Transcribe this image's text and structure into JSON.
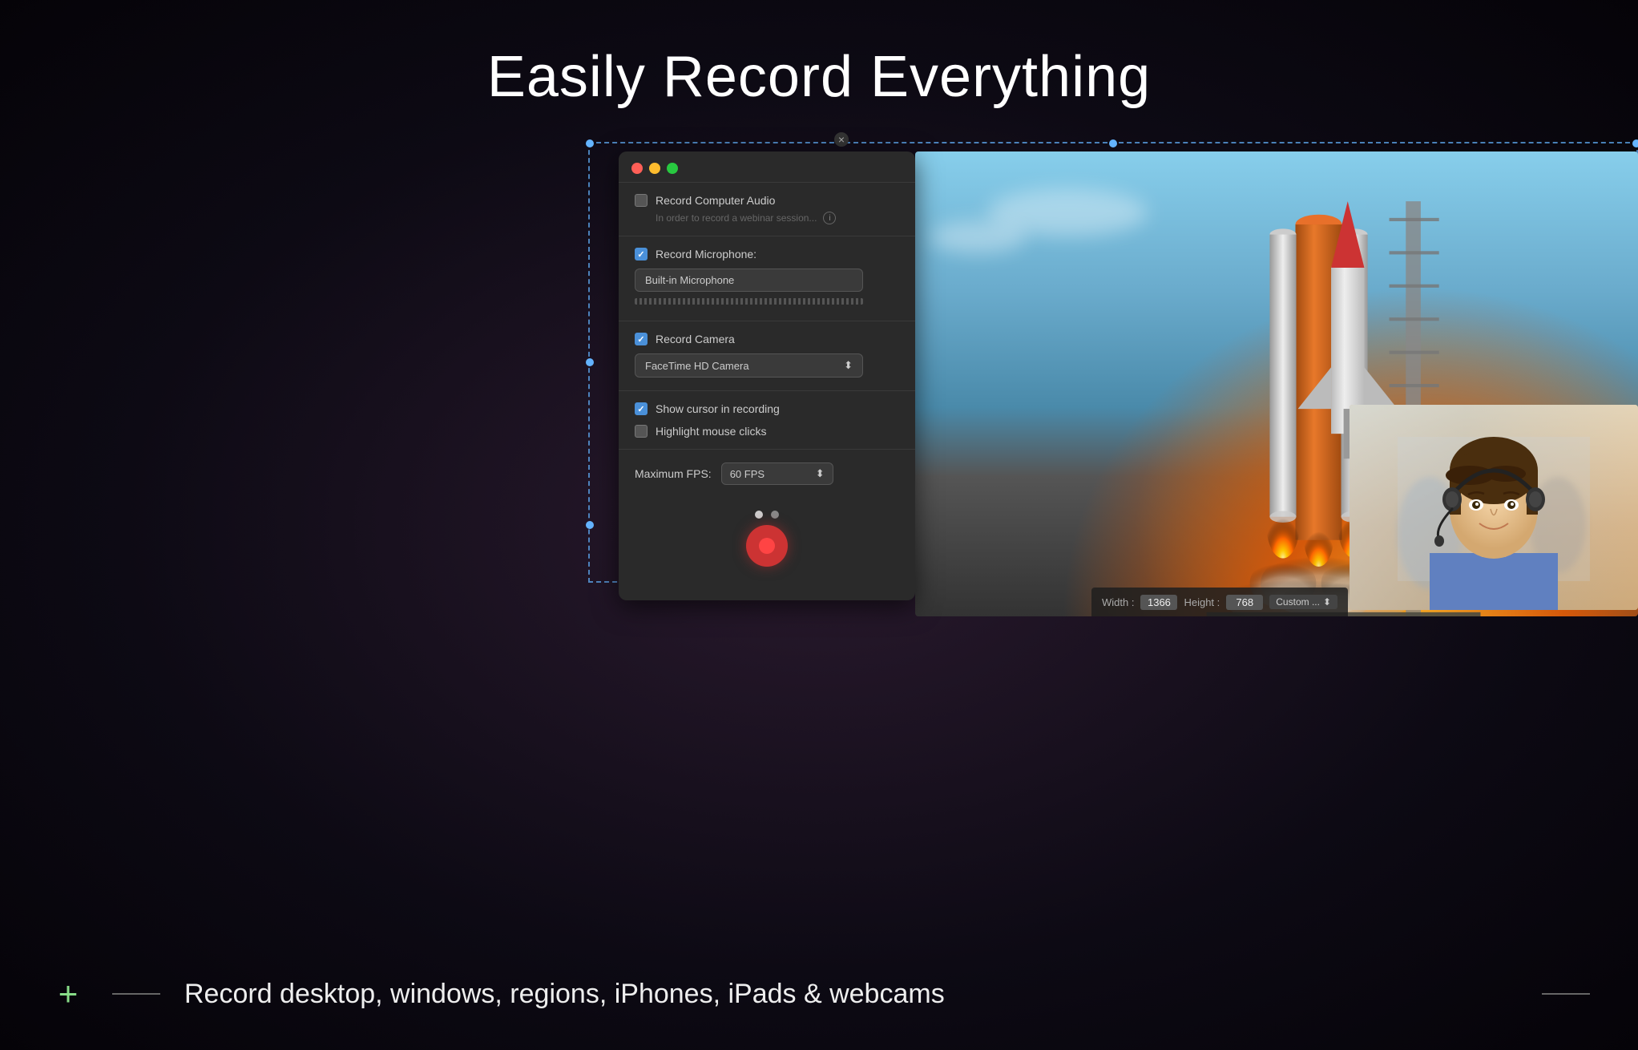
{
  "page": {
    "title": "Easily Record Everything",
    "subtitle": "Record desktop, windows, regions, iPhones, iPads & webcams"
  },
  "control_panel": {
    "record_audio_label": "Record Computer Audio",
    "record_audio_checked": false,
    "info_text": "In order to record a webinar session...",
    "record_microphone_label": "Record Microphone:",
    "record_microphone_checked": true,
    "microphone_value": "Built-in Microphone",
    "record_camera_label": "Record Camera",
    "record_camera_checked": true,
    "camera_value": "FaceTime HD Camera",
    "show_cursor_label": "Show cursor in recording",
    "show_cursor_checked": true,
    "highlight_clicks_label": "Highlight mouse clicks",
    "highlight_clicks_checked": false,
    "fps_label": "Maximum FPS:",
    "fps_value": "60 FPS",
    "record_button_label": "Record"
  },
  "dimension_bar": {
    "width_label": "Width :",
    "width_value": "1366",
    "height_label": "Height :",
    "height_value": "768",
    "custom_label": "Custom ..."
  },
  "bottom_bar": {
    "description": "Record desktop, windows, regions, iPhones, iPads & webcams"
  },
  "icons": {
    "close": "×",
    "checkmark": "✓",
    "info": "i",
    "arrow_up_down": "⬍",
    "plus": "+"
  },
  "colors": {
    "accent_blue": "#64b4ff",
    "record_red": "#cc3333",
    "checked_blue": "#4a90d9",
    "panel_bg": "#2a2a2a",
    "green_plus": "#88dd88"
  }
}
